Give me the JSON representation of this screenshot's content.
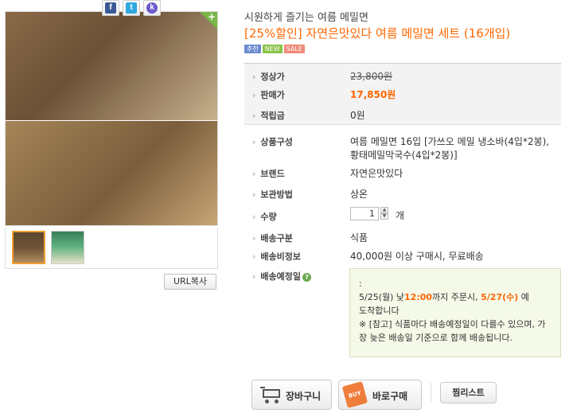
{
  "product": {
    "subtitle": "시원하게 즐기는 여름 메밀면",
    "title": "[25%할인] 자연은맛있다 여름 메밀면 세트 (16개입)",
    "badges": [
      "추천",
      "NEW",
      "SALE"
    ]
  },
  "gallery": {
    "main_image": "noodle-bowls-photo",
    "thumbnails": [
      "thumbnail-noodle-bowls",
      "thumbnail-product-package"
    ]
  },
  "share": {
    "facebook_icon": "f",
    "twitter_icon": "t",
    "kakaostory_icon": "k",
    "url_copy_label": "URL복사"
  },
  "info_rows": {
    "regular_price": {
      "label": "정상가",
      "value": "23,800원"
    },
    "sale_price": {
      "label": "판매가",
      "value": "17,850원"
    },
    "points": {
      "label": "적립금",
      "value": "0원"
    },
    "composition": {
      "label": "상품구성",
      "value_line1": "여름 메밀면 16입 [가쓰오 메밀 냉소바(4입*2봉),",
      "value_line2": "황태메밀막국수(4입*2봉)]"
    },
    "brand": {
      "label": "브랜드",
      "value": "자연은맛있다"
    },
    "storage": {
      "label": "보관방법",
      "value": "상온"
    },
    "quantity": {
      "label": "수량",
      "value": "1",
      "unit": "개"
    },
    "delivery_type": {
      "label": "배송구분",
      "value": "식품"
    },
    "shipping_info": {
      "label": "배송비정보",
      "value": "40,000원 이상 구매시, 무료배송"
    },
    "delivery_schedule": {
      "label": "배송예정일",
      "help_icon": "?"
    }
  },
  "delivery_box": {
    "line_colon": ":",
    "order_prefix": "5/25(월) 낮",
    "order_time": "12:00",
    "order_mid": "까지 주문시, ",
    "arrival_date": "5/27(수)",
    "order_suffix": " 예",
    "line2": "도착합니다",
    "note": "※ [참고] 식품마다 배송예정일이 다를수 있으며, 가장 늦은 배송일 기준으로 함께 배송됩니다."
  },
  "buttons": {
    "cart_label": "장바구니",
    "buy_label": "바로구매",
    "buy_tag": "BUY",
    "wishlist_label": "찜리스트"
  },
  "colors": {
    "accent": "#ff6600",
    "delivery_bg": "#f5f9e8"
  }
}
